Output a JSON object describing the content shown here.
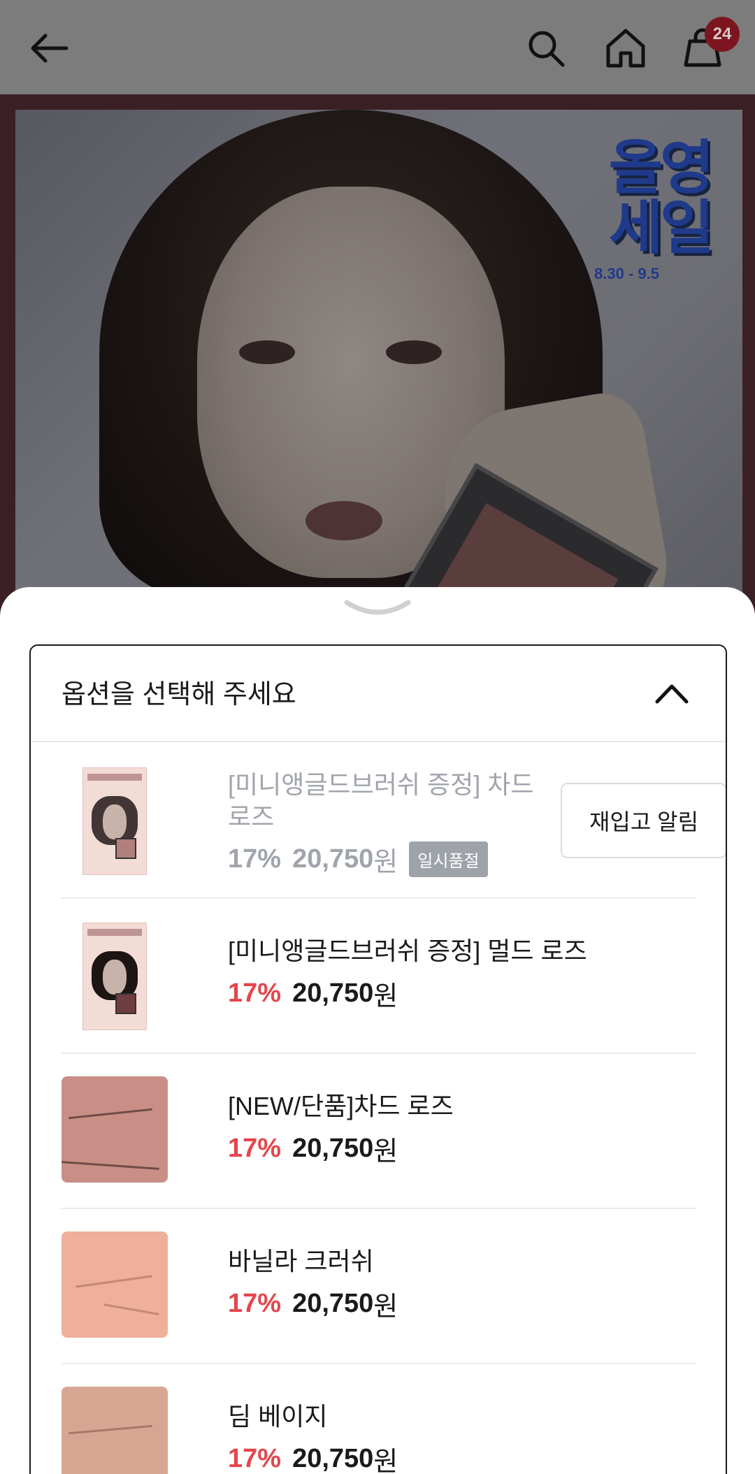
{
  "header": {
    "cart_count": "24",
    "icons": [
      "back-arrow-icon",
      "search-icon",
      "home-icon",
      "shopping-bag-icon"
    ]
  },
  "hero": {
    "promo_line1": "올영",
    "promo_line2": "세일",
    "promo_dates": "8.30 - 9.5"
  },
  "sheet": {
    "select_title": "옵션을 선택해 주세요",
    "options": [
      {
        "name": "[미니앵글드브러쉬 증정] 차드 로즈",
        "discount": "17%",
        "price": "20,750",
        "currency": "원",
        "status": "일시품절",
        "action": "재입고 알림"
      },
      {
        "name": "[미니앵글드브러쉬 증정] 멀드 로즈",
        "discount": "17%",
        "price": "20,750",
        "currency": "원"
      },
      {
        "name": "[NEW/단품]차드 로즈",
        "discount": "17%",
        "price": "20,750",
        "currency": "원",
        "swatch_color": "#c98f86"
      },
      {
        "name": "바닐라 크러쉬",
        "discount": "17%",
        "price": "20,750",
        "currency": "원",
        "swatch_color": "#eeaf9b"
      },
      {
        "name": "딤 베이지",
        "discount": "17%",
        "price": "20,750",
        "currency": "원",
        "swatch_color": "#d7a693"
      }
    ]
  }
}
